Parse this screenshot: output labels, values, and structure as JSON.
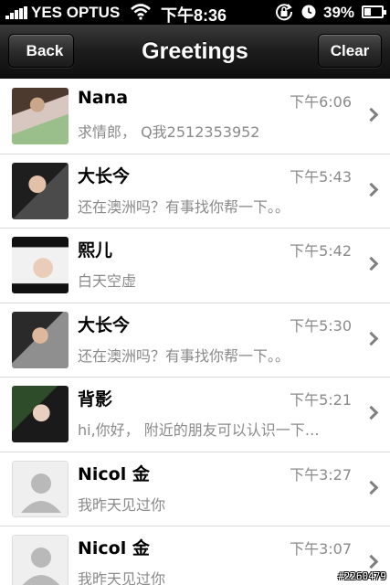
{
  "status_bar": {
    "carrier": "YES OPTUS",
    "time": "下午8:36",
    "battery_percent": "39%",
    "battery_level": 0.39,
    "icons": [
      "signal-icon",
      "wifi-icon",
      "rotation-lock-icon",
      "alarm-icon",
      "battery-icon"
    ]
  },
  "nav": {
    "back_label": "Back",
    "title": "Greetings",
    "clear_label": "Clear"
  },
  "messages": [
    {
      "name": "Nana",
      "time": "下午6:06",
      "preview": "求情郎，  Q我2512353952",
      "avatar": "photo"
    },
    {
      "name": "大长今",
      "time": "下午5:43",
      "preview": "还在澳洲吗？有事找你帮一下。。",
      "avatar": "photo"
    },
    {
      "name": "熙儿",
      "time": "下午5:42",
      "preview": "白天空虚",
      "avatar": "photo"
    },
    {
      "name": "大长今",
      "time": "下午5:30",
      "preview": "还在澳洲吗？有事找你帮一下。。",
      "avatar": "photo"
    },
    {
      "name": "背影",
      "time": "下午5:21",
      "preview": "hi,你好， 附近的朋友可以认识一下…",
      "avatar": "photo"
    },
    {
      "name": "Nicol  金",
      "time": "下午3:27",
      "preview": "我昨天见过你",
      "avatar": "default"
    },
    {
      "name": "Nicol  金",
      "time": "下午3:07",
      "preview": "我昨天见过你",
      "avatar": "default"
    }
  ],
  "watermark": "#2260479",
  "colors": {
    "nav_background": "#1c1c1c",
    "secondary_text": "#8a8a8a",
    "divider": "#d9d9d9"
  }
}
